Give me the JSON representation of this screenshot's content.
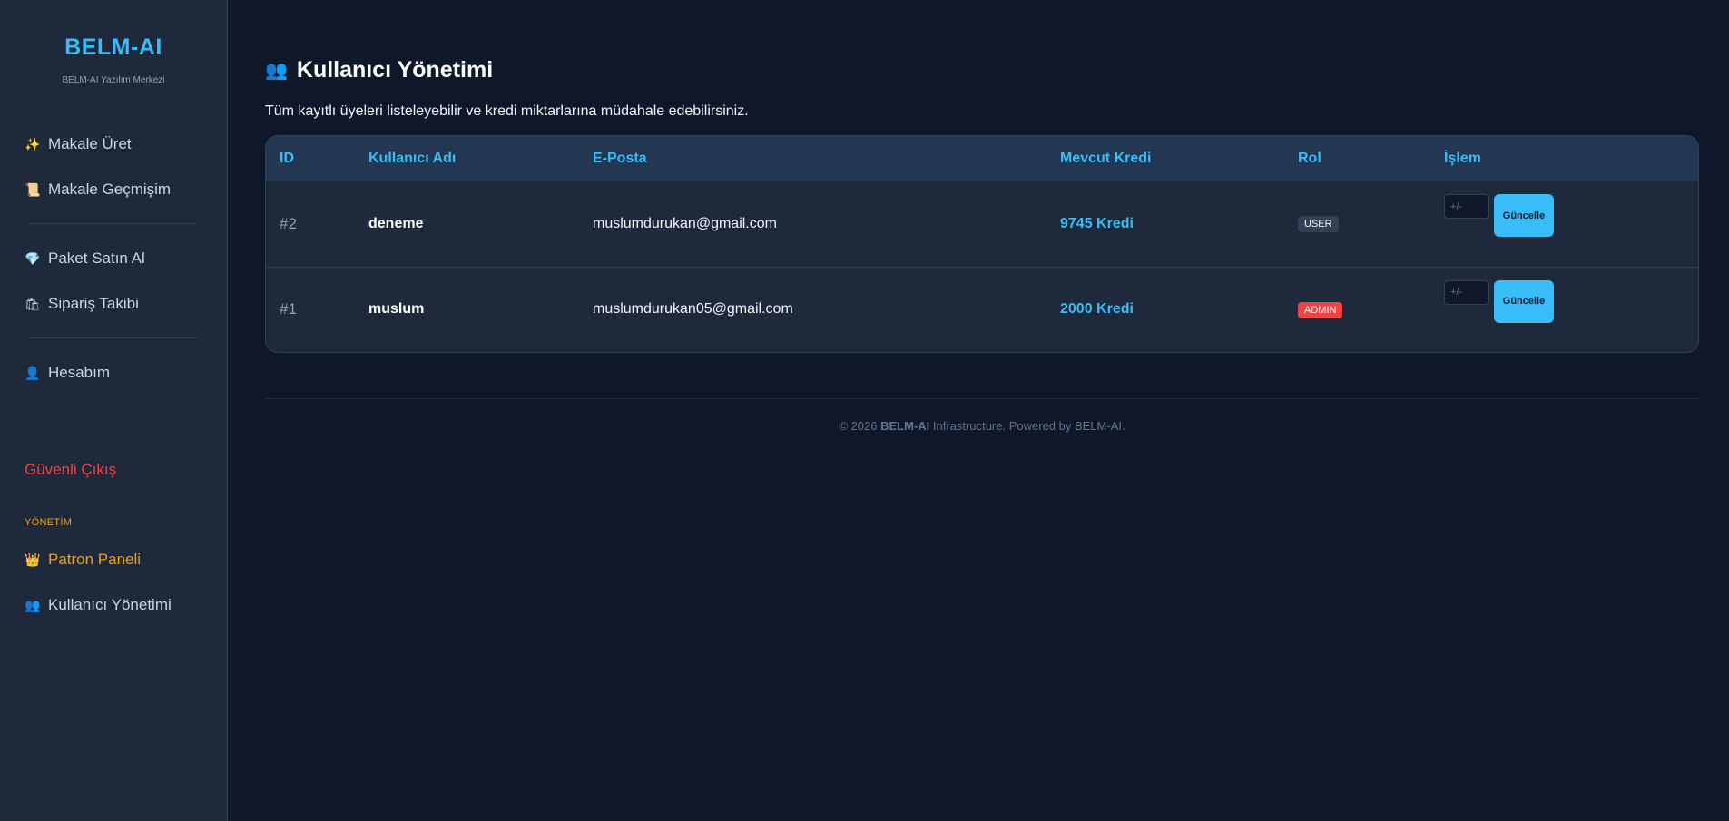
{
  "sidebar": {
    "brand": "BELM-AI",
    "subtitle": "BELM-AI Yazılım Merkezi",
    "group1": [
      {
        "icon": "✨",
        "label": "Makale Üret"
      },
      {
        "icon": "📜",
        "label": "Makale Geçmişim"
      }
    ],
    "group2": [
      {
        "icon": "💎",
        "label": "Paket Satın Al"
      },
      {
        "icon": "🛍",
        "label": "Sipariş Takibi"
      }
    ],
    "group3": [
      {
        "icon": "👤",
        "label": "Hesabım"
      }
    ],
    "logout": "Güvenli Çıkış",
    "admin_section": "YÖNETİM",
    "admin_items": [
      {
        "icon": "👑",
        "label": "Patron Paneli"
      },
      {
        "icon": "👥",
        "label": "Kullanıcı Yönetimi"
      }
    ]
  },
  "main": {
    "title_icon": "👥",
    "title": "Kullanıcı Yönetimi",
    "description": "Tüm kayıtlı üyeleri listeleyebilir ve kredi miktarlarına müdahale edebilirsiniz.",
    "table": {
      "headers": [
        "ID",
        "Kullanıcı Adı",
        "E-Posta",
        "Mevcut Kredi",
        "Rol",
        "İşlem"
      ],
      "rows": [
        {
          "id": "#2",
          "username": "deneme",
          "email": "muslumdurukan@gmail.com",
          "credit": "9745 Kredi",
          "role": "USER",
          "input_placeholder": "+/-",
          "button": "Güncelle"
        },
        {
          "id": "#1",
          "username": "muslum",
          "email": "muslumdurukan05@gmail.com",
          "credit": "2000 Kredi",
          "role": "ADMIN",
          "input_placeholder": "+/-",
          "button": "Güncelle"
        }
      ]
    }
  },
  "footer": {
    "prefix": "© 2026 ",
    "brand": "BELM-AI",
    "suffix": " Infrastructure. Powered by BELM-AI."
  },
  "colors": {
    "accent": "#38bdf8",
    "danger": "#ef4444",
    "gold": "#f59e0b",
    "background": "#0f172a",
    "panel": "#1e293b"
  }
}
